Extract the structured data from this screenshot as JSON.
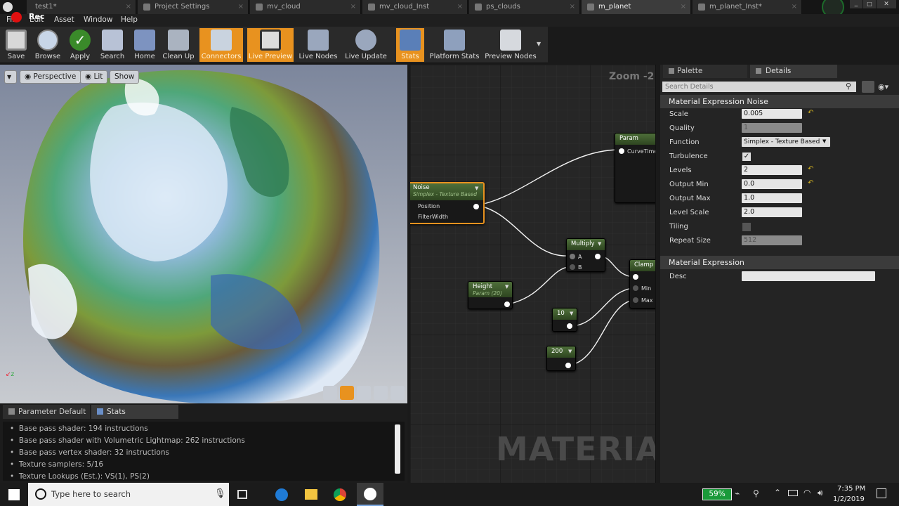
{
  "tabs": [
    {
      "label": "test1*",
      "active": false
    },
    {
      "label": "Project Settings",
      "active": false
    },
    {
      "label": "mv_cloud",
      "active": false
    },
    {
      "label": "mv_cloud_Inst",
      "active": false
    },
    {
      "label": "ps_clouds",
      "active": false
    },
    {
      "label": "m_planet",
      "active": true
    },
    {
      "label": "m_planet_Inst*",
      "active": false
    }
  ],
  "rec_label": "Rec",
  "menu": [
    "File",
    "Edit",
    "Asset",
    "Window",
    "Help"
  ],
  "toolbar": [
    {
      "label": "Save",
      "icon": "save-icon",
      "active": false
    },
    {
      "label": "Browse",
      "icon": "browse-icon",
      "active": false
    },
    {
      "label": "Apply",
      "icon": "apply-icon",
      "active": false
    },
    {
      "label": "Search",
      "icon": "search-icon",
      "active": false
    },
    {
      "label": "Home",
      "icon": "home-icon",
      "active": false
    },
    {
      "label": "Clean Up",
      "icon": "clean-up-icon",
      "active": false
    },
    {
      "label": "Connectors",
      "icon": "connectors-icon",
      "active": true
    },
    {
      "label": "Live Preview",
      "icon": "live-preview-icon",
      "active": true
    },
    {
      "label": "Live Nodes",
      "icon": "live-nodes-icon",
      "active": false
    },
    {
      "label": "Live Update",
      "icon": "live-update-icon",
      "active": false
    },
    {
      "label": "Stats",
      "icon": "stats-icon",
      "active": true
    },
    {
      "label": "Platform Stats",
      "icon": "platform-stats-icon",
      "active": false
    },
    {
      "label": "Preview Nodes",
      "icon": "preview-nodes-icon",
      "active": false
    }
  ],
  "viewport": {
    "perspective": "Perspective",
    "lit": "Lit",
    "show": "Show"
  },
  "bottom_tabs": [
    "Parameter Default",
    "Stats"
  ],
  "stats_lines": [
    "Base pass shader: 194 instructions",
    "Base pass shader with Volumetric Lightmap: 262 instructions",
    "Base pass vertex shader: 32 instructions",
    "Texture samplers: 5/16",
    "Texture Lookups (Est.): VS(1), PS(2)"
  ],
  "graph": {
    "zoom": "Zoom -2",
    "watermark": "MATERIAL",
    "nodes": {
      "noise": {
        "title": "Noise",
        "subtitle": "Simplex - Texture Based",
        "pins": [
          "Position",
          "FilterWidth"
        ]
      },
      "param": {
        "title": "Param",
        "pin": "CurveTime"
      },
      "multiply": {
        "title": "Multiply",
        "pins": [
          "A",
          "B"
        ]
      },
      "clamp": {
        "title": "Clamp (",
        "pins": [
          "Min",
          "Max"
        ]
      },
      "height": {
        "title": "Height",
        "subtitle": "Param (20)"
      },
      "c10": {
        "title": "10"
      },
      "c200": {
        "title": "200"
      }
    }
  },
  "details": {
    "palette_tab": "Palette",
    "details_tab": "Details",
    "search_placeholder": "Search Details",
    "section1": "Material Expression Noise",
    "props": [
      {
        "name": "Scale",
        "value": "0.005",
        "disabled": false
      },
      {
        "name": "Quality",
        "value": "1",
        "disabled": true
      },
      {
        "name": "Function",
        "value": "Simplex - Texture Based",
        "disabled": false
      },
      {
        "name": "Turbulence",
        "value": "",
        "checked": true
      },
      {
        "name": "Levels",
        "value": "2",
        "disabled": false
      },
      {
        "name": "Output Min",
        "value": "0.0",
        "disabled": false
      },
      {
        "name": "Output Max",
        "value": "1.0",
        "disabled": false
      },
      {
        "name": "Level Scale",
        "value": "2.0",
        "disabled": false
      },
      {
        "name": "Tiling",
        "value": "",
        "checked": false
      },
      {
        "name": "Repeat Size",
        "value": "512",
        "disabled": true
      }
    ],
    "section2": "Material Expression",
    "desc_label": "Desc",
    "desc_value": ""
  },
  "taskbar": {
    "search_placeholder": "Type here to search",
    "battery": "59%",
    "time": "7:35 PM",
    "date": "1/2/2019"
  }
}
